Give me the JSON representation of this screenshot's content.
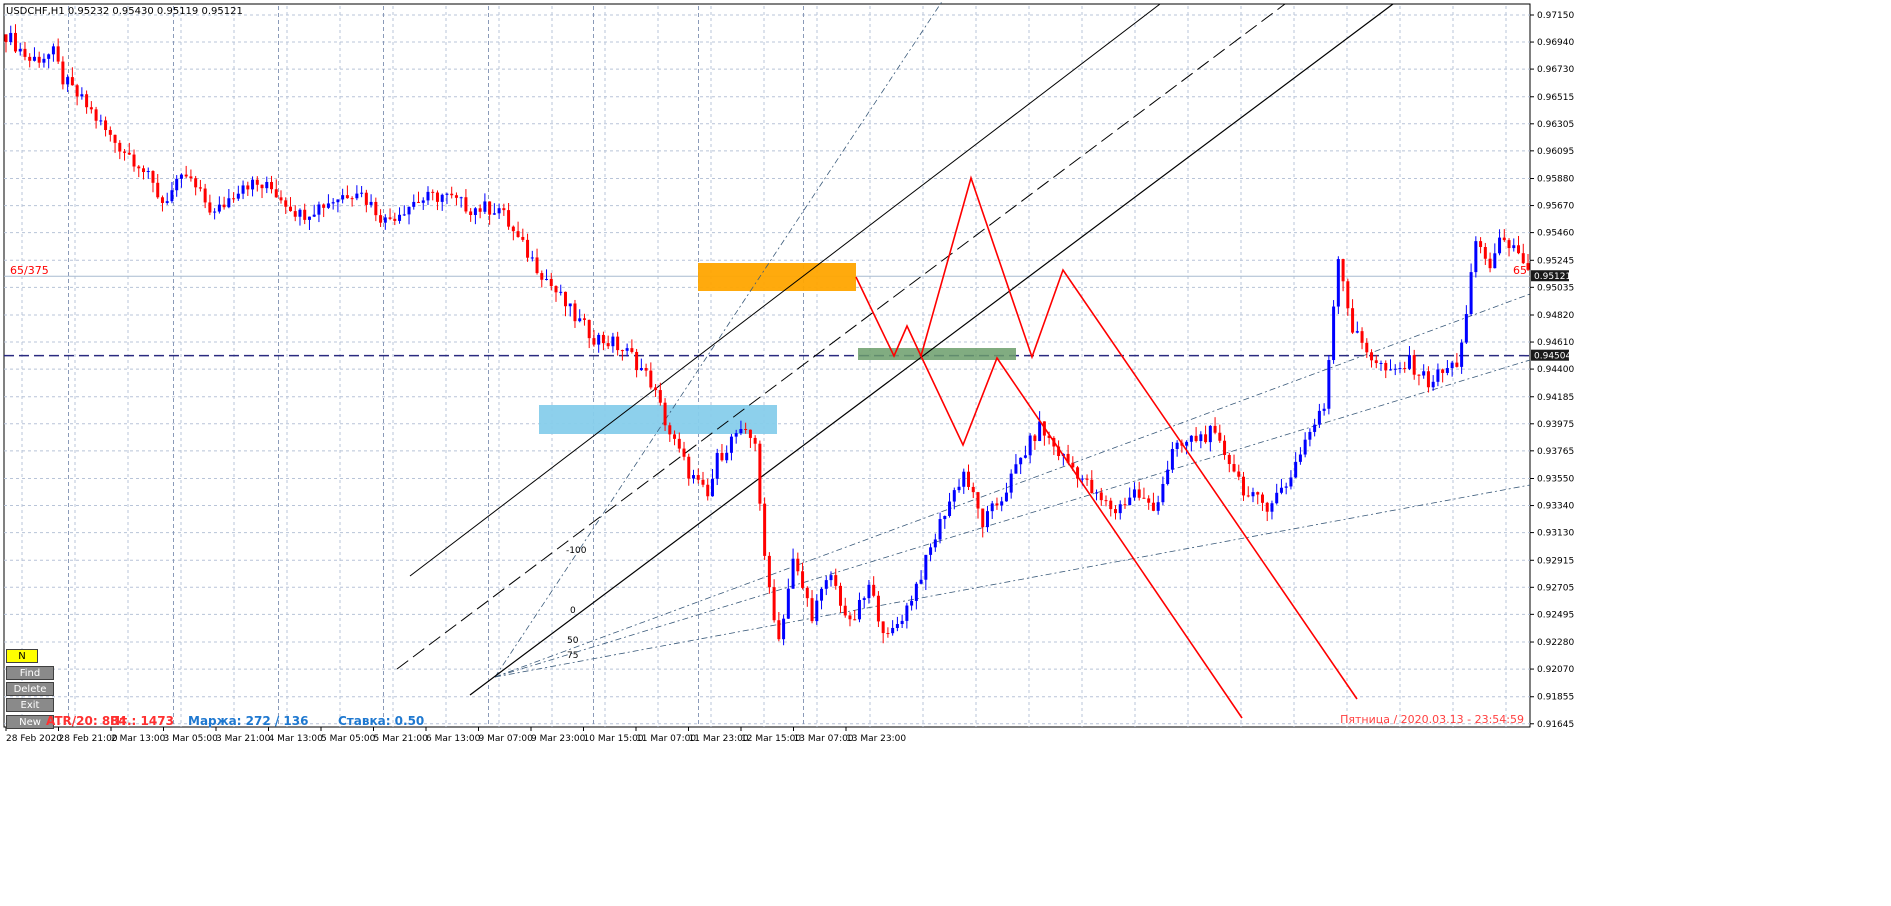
{
  "chart_data": {
    "type": "candlestick",
    "symbol_header": "USDCHF,H1  0.95232 0.95430 0.95119 0.95121",
    "ylim": [
      0.9162,
      0.9722
    ],
    "y_ticks": [
      "0.97150",
      "0.96940",
      "0.96730",
      "0.96515",
      "0.96305",
      "0.96095",
      "0.95880",
      "0.95670",
      "0.95460",
      "0.95245",
      "0.95035",
      "0.94820",
      "0.94610",
      "0.94400",
      "0.94185",
      "0.93975",
      "0.93765",
      "0.93550",
      "0.93340",
      "0.93130",
      "0.92915",
      "0.92705",
      "0.92495",
      "0.92280",
      "0.92070",
      "0.91855",
      "0.91645"
    ],
    "x_ticks": [
      "28 Feb 2020",
      "28 Feb 21:00",
      "2 Mar 13:00",
      "3 Mar 05:00",
      "3 Mar 21:00",
      "4 Mar 13:00",
      "5 Mar 05:00",
      "5 Mar 21:00",
      "6 Mar 13:00",
      "9 Mar 07:00",
      "9 Mar 23:00",
      "10 Mar 15:00",
      "11 Mar 07:00",
      "11 Mar 23:00",
      "12 Mar 15:00",
      "13 Mar 07:00",
      "13 Mar 23:00"
    ],
    "path_points": [
      [
        0,
        0.97
      ],
      [
        5,
        0.968
      ],
      [
        10,
        0.9685
      ],
      [
        12,
        0.9665
      ],
      [
        18,
        0.964
      ],
      [
        22,
        0.962
      ],
      [
        28,
        0.96
      ],
      [
        33,
        0.957
      ],
      [
        38,
        0.959
      ],
      [
        44,
        0.956
      ],
      [
        50,
        0.9585
      ],
      [
        56,
        0.958
      ],
      [
        62,
        0.956
      ],
      [
        68,
        0.957
      ],
      [
        74,
        0.958
      ],
      [
        80,
        0.9555
      ],
      [
        86,
        0.957
      ],
      [
        92,
        0.9575
      ],
      [
        98,
        0.9565
      ],
      [
        104,
        0.9565
      ],
      [
        108,
        0.954
      ],
      [
        112,
        0.952
      ],
      [
        116,
        0.95
      ],
      [
        120,
        0.948
      ],
      [
        124,
        0.9465
      ],
      [
        128,
        0.946
      ],
      [
        132,
        0.945
      ],
      [
        136,
        0.943
      ],
      [
        140,
        0.939
      ],
      [
        144,
        0.936
      ],
      [
        148,
        0.934
      ],
      [
        150,
        0.937
      ],
      [
        154,
        0.939
      ],
      [
        158,
        0.9385
      ],
      [
        160,
        0.929
      ],
      [
        163,
        0.923
      ],
      [
        166,
        0.929
      ],
      [
        170,
        0.925
      ],
      [
        174,
        0.928
      ],
      [
        178,
        0.924
      ],
      [
        182,
        0.927
      ],
      [
        186,
        0.923
      ],
      [
        190,
        0.9255
      ],
      [
        194,
        0.929
      ],
      [
        198,
        0.933
      ],
      [
        202,
        0.936
      ],
      [
        206,
        0.932
      ],
      [
        210,
        0.934
      ],
      [
        214,
        0.937
      ],
      [
        218,
        0.9395
      ],
      [
        222,
        0.9375
      ],
      [
        226,
        0.936
      ],
      [
        230,
        0.934
      ],
      [
        234,
        0.933
      ],
      [
        238,
        0.9345
      ],
      [
        242,
        0.933
      ],
      [
        246,
        0.9375
      ],
      [
        250,
        0.9385
      ],
      [
        254,
        0.939
      ],
      [
        258,
        0.937
      ],
      [
        262,
        0.934
      ],
      [
        266,
        0.9335
      ],
      [
        270,
        0.935
      ],
      [
        274,
        0.9385
      ],
      [
        278,
        0.941
      ],
      [
        281,
        0.953
      ],
      [
        284,
        0.947
      ],
      [
        288,
        0.945
      ],
      [
        292,
        0.9435
      ],
      [
        296,
        0.9445
      ],
      [
        300,
        0.943
      ],
      [
        304,
        0.944
      ],
      [
        306,
        0.9445
      ],
      [
        308,
        0.948
      ],
      [
        310,
        0.954
      ],
      [
        313,
        0.952
      ],
      [
        316,
        0.9545
      ],
      [
        319,
        0.9525
      ],
      [
        321,
        0.9512
      ]
    ],
    "current_price_label": "0.95121",
    "level_price_label": "0.94504",
    "left_label": "65/375",
    "right_label": "65",
    "fib_labels": [
      "-100",
      "0",
      "50",
      "75"
    ],
    "datetime": "Пятница / 2020.03.13 - 23:54:59",
    "atr_text": "ATR/20: 884",
    "pt_text": "Пт.: 1473",
    "margin_text": "Маржа: 272 / 136",
    "rate_text": "Ставка: 0.50"
  },
  "buttons": {
    "n": "N",
    "find": "Find",
    "delete": "Delete",
    "exit": "Exit",
    "new": "New"
  },
  "colors": {
    "bull": "#0000ff",
    "bear": "#ff0000",
    "grid": "#b8c4d8",
    "projection": "#ff0000",
    "orange_zone": "#ffa500",
    "blue_zone": "#87ceeb",
    "green_zone": "#6b9e6b",
    "level_line": "#2a2a80",
    "price_line": "#a8bcd0"
  }
}
